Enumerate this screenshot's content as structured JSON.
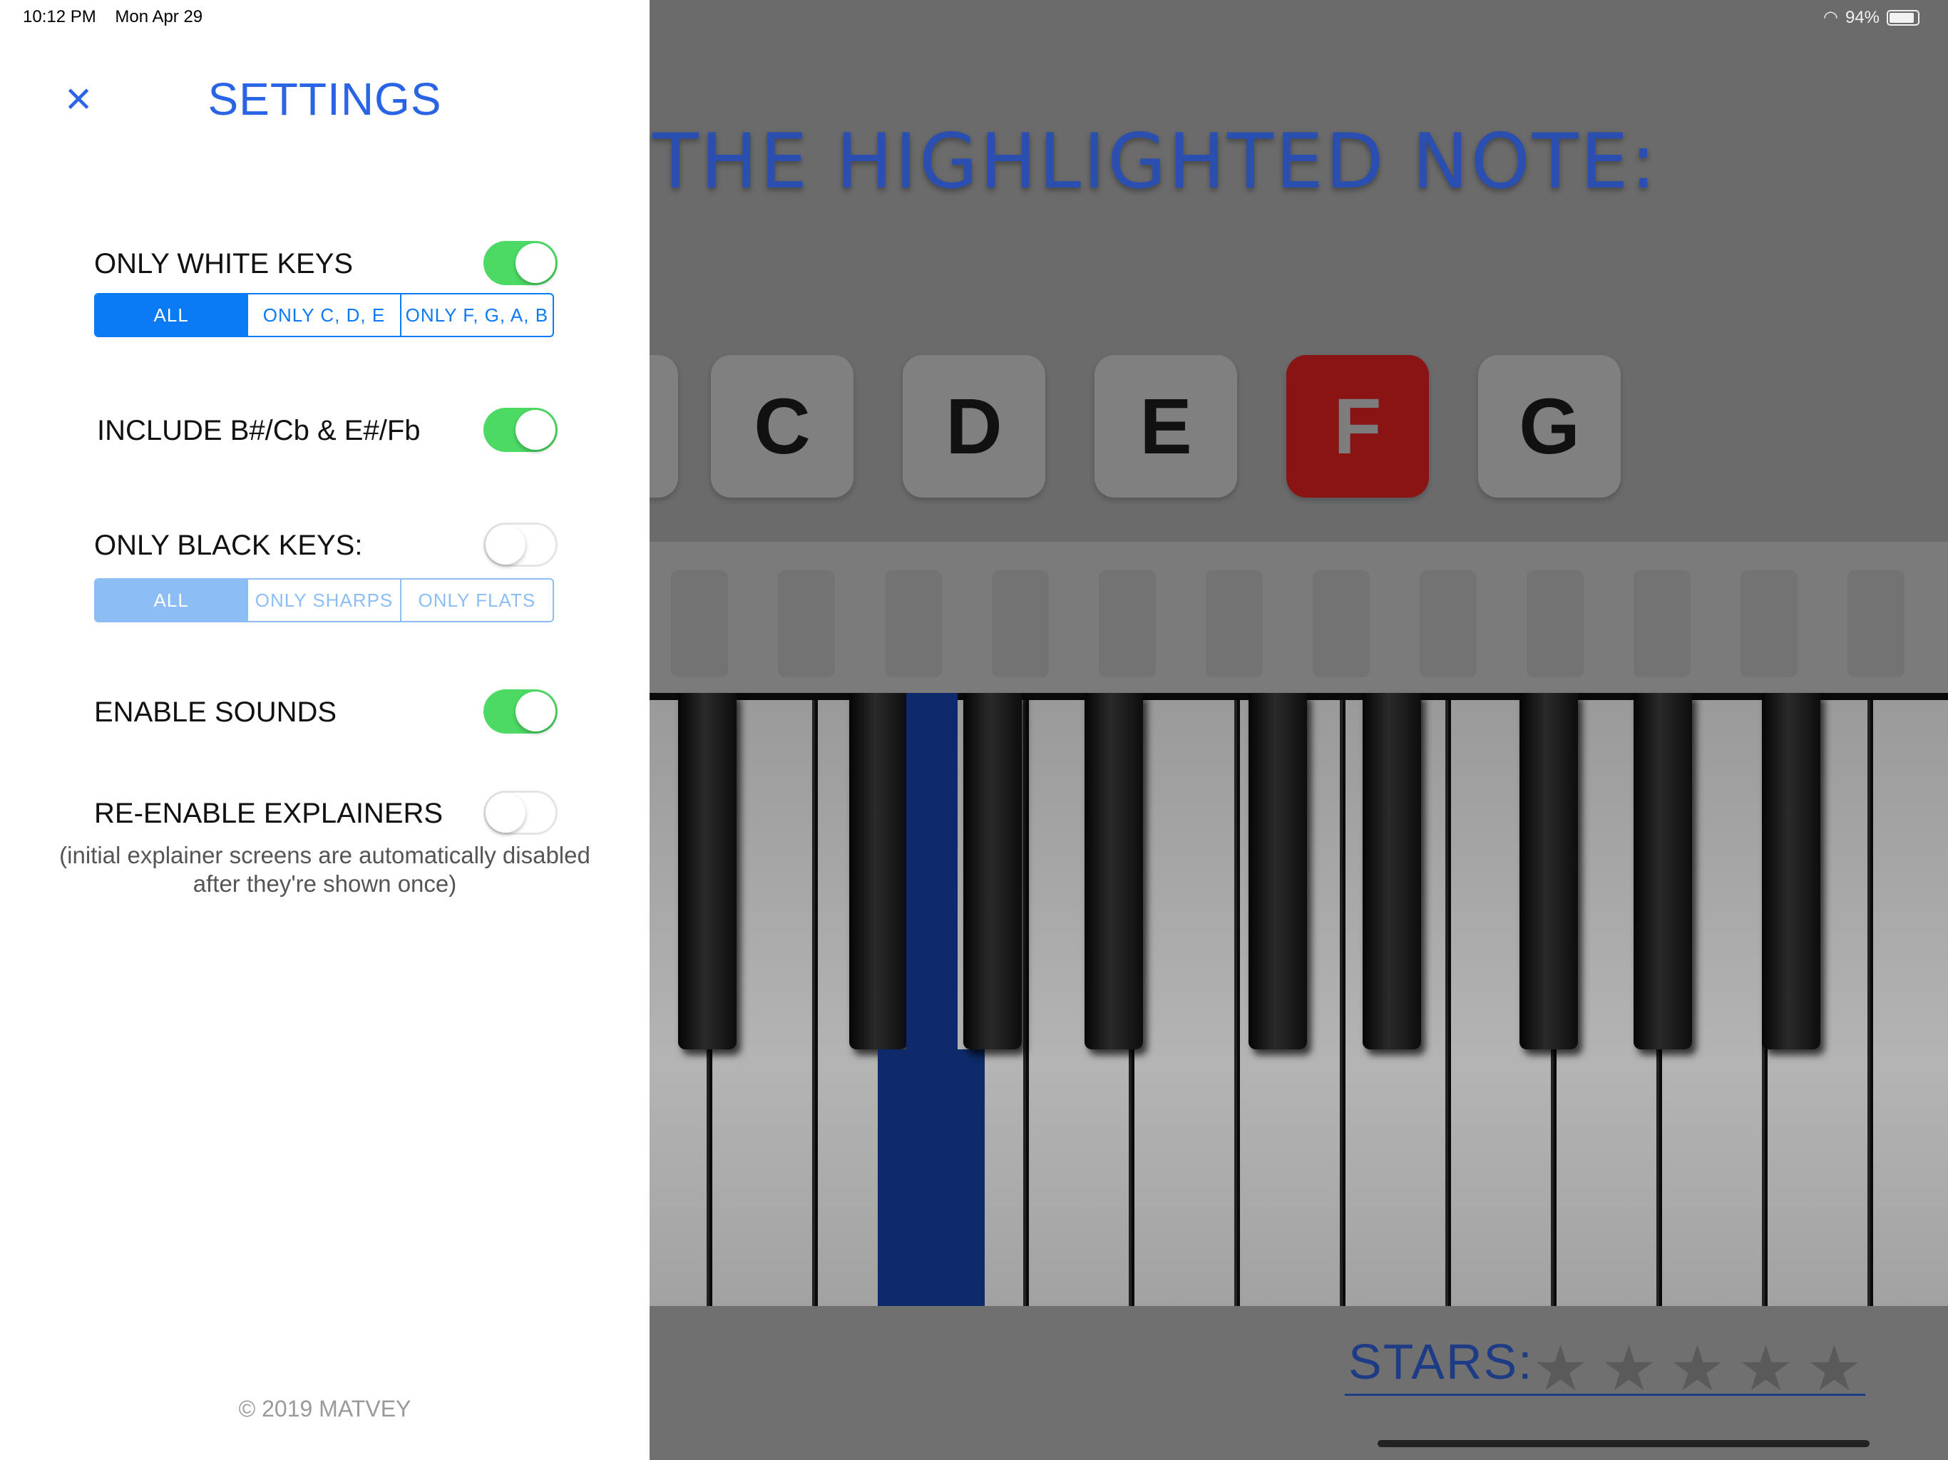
{
  "status_bar": {
    "time": "10:12 PM",
    "date": "Mon Apr 29",
    "battery": "94%"
  },
  "settings": {
    "title": "SETTINGS",
    "close_icon": "×",
    "only_white_keys": {
      "label": "ONLY WHITE KEYS",
      "on": true,
      "segments": [
        "ALL",
        "ONLY C, D, E",
        "ONLY F, G, A, B"
      ],
      "selected": "ALL"
    },
    "include_enharmonics": {
      "label": "INCLUDE B#/Cb & E#/Fb",
      "on": true
    },
    "only_black_keys": {
      "label": "ONLY BLACK KEYS:",
      "on": false,
      "segments": [
        "ALL",
        "ONLY SHARPS",
        "ONLY FLATS"
      ],
      "selected": "ALL"
    },
    "enable_sounds": {
      "label": "ENABLE SOUNDS",
      "on": true
    },
    "reenable_explainers": {
      "label": "RE-ENABLE EXPLAINERS",
      "on": false,
      "note_line1": "(initial explainer screens are automatically disabled",
      "note_line2": "after they're shown once)"
    },
    "copyright": "© 2019 MATVEY"
  },
  "game": {
    "prompt": "THE HIGHLIGHTED NOTE:",
    "note_buttons": [
      "C",
      "D",
      "E",
      "F",
      "G"
    ],
    "highlighted_button": "F",
    "stars_label": "STARS:",
    "stars_total": 5,
    "stars_earned": 0,
    "colors": {
      "toggle_on": "#4cd964",
      "accent_blue": "#0a7bf5",
      "title_blue": "#2a64e6",
      "highlight_key": "#0f2a6a",
      "active_note": "#8a1414"
    }
  }
}
